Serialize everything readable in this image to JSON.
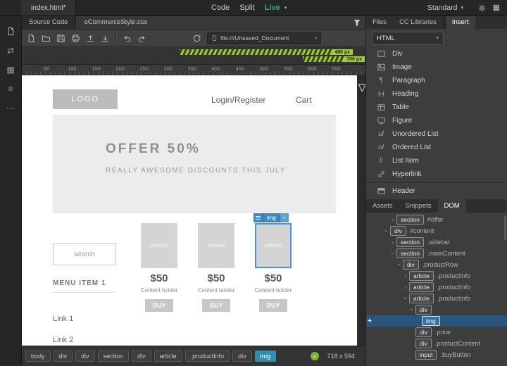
{
  "icons": {
    "chevron_down": "▾",
    "chevron_right": "›",
    "check": "✓",
    "plus": "+",
    "ellipsis": "⋯",
    "swap": "⇄",
    "grid": "▦",
    "lines": "≡",
    "triangle_down": "▽",
    "paragraph": "¶"
  },
  "topbar": {
    "file_tab": "index.html*",
    "modes": [
      "Code",
      "Split",
      "Live"
    ],
    "workspace": "Standard"
  },
  "docbar": {
    "source_tab": "Source Code",
    "css_file": "eCommerceStyle.css",
    "address": "file:///Unsaved_Document"
  },
  "media": {
    "bp_480": "480 px",
    "bp_700": "700 px"
  },
  "ruler": [
    "50",
    "100",
    "150",
    "200",
    "250",
    "300",
    "350",
    "400",
    "450",
    "500",
    "550",
    "600",
    "650"
  ],
  "page": {
    "logo": "LOGO",
    "login": "Login/Register",
    "cart": "Cart",
    "offer_title": "OFFER 50%",
    "offer_subtitle": "REALLY AWESOME DISCOUNTS THIS JULY",
    "search": "search",
    "menu_item": "MENU ITEM 1",
    "link1": "Link 1",
    "link2": "Link 2",
    "products": [
      {
        "placeholder": "200x200",
        "price": "$50",
        "caption": "Content holder",
        "buy": "BUY"
      },
      {
        "placeholder": "200x200",
        "price": "$50",
        "caption": "Content holder",
        "buy": "BUY"
      },
      {
        "placeholder": "200x200",
        "price": "$50",
        "caption": "Content holder",
        "buy": "BUY"
      }
    ],
    "hud_label": "img"
  },
  "tagbar": {
    "tags": [
      "body",
      "div",
      "div",
      "section",
      "div",
      "article",
      ".productInfo",
      "div",
      "img"
    ],
    "size": "718 x 594"
  },
  "panel": {
    "tabs": {
      "files": "Files",
      "cc": "CC Libraries",
      "insert": "Insert"
    },
    "category": "HTML",
    "items": [
      {
        "label": "Div"
      },
      {
        "label": "Image"
      },
      {
        "label": "Paragraph"
      },
      {
        "label": "Heading"
      },
      {
        "label": "Table"
      },
      {
        "label": "Figure"
      },
      {
        "label": "Unordered List",
        "glyph": "ul"
      },
      {
        "label": "Ordered List",
        "glyph": "ol"
      },
      {
        "label": "List Item",
        "glyph": "li"
      },
      {
        "label": "Hyperlink"
      },
      {
        "label": "Header"
      }
    ],
    "bottom_tabs": {
      "assets": "Assets",
      "snippets": "Snippets",
      "dom": "DOM"
    },
    "dom": [
      {
        "tag": "section",
        "label": "#offer",
        "expanded": false
      },
      {
        "tag": "div",
        "label": "#content",
        "expanded": true
      },
      {
        "tag": "section",
        "label": ".sidebar",
        "expanded": false
      },
      {
        "tag": "section",
        "label": ".mainContent",
        "expanded": true
      },
      {
        "tag": "div",
        "label": ".productRow",
        "expanded": true
      },
      {
        "tag": "article",
        "label": ".productInfo",
        "expanded": false
      },
      {
        "tag": "article",
        "label": ".productInfo",
        "expanded": false
      },
      {
        "tag": "article",
        "label": ".productInfo",
        "expanded": true
      },
      {
        "tag": "div",
        "label": "",
        "expanded": true
      },
      {
        "tag": "img",
        "label": "",
        "selected": true
      },
      {
        "tag": "div",
        "label": ".price"
      },
      {
        "tag": "div",
        "label": ".productContent"
      },
      {
        "tag": "input",
        "label": ".buyButton"
      }
    ]
  }
}
